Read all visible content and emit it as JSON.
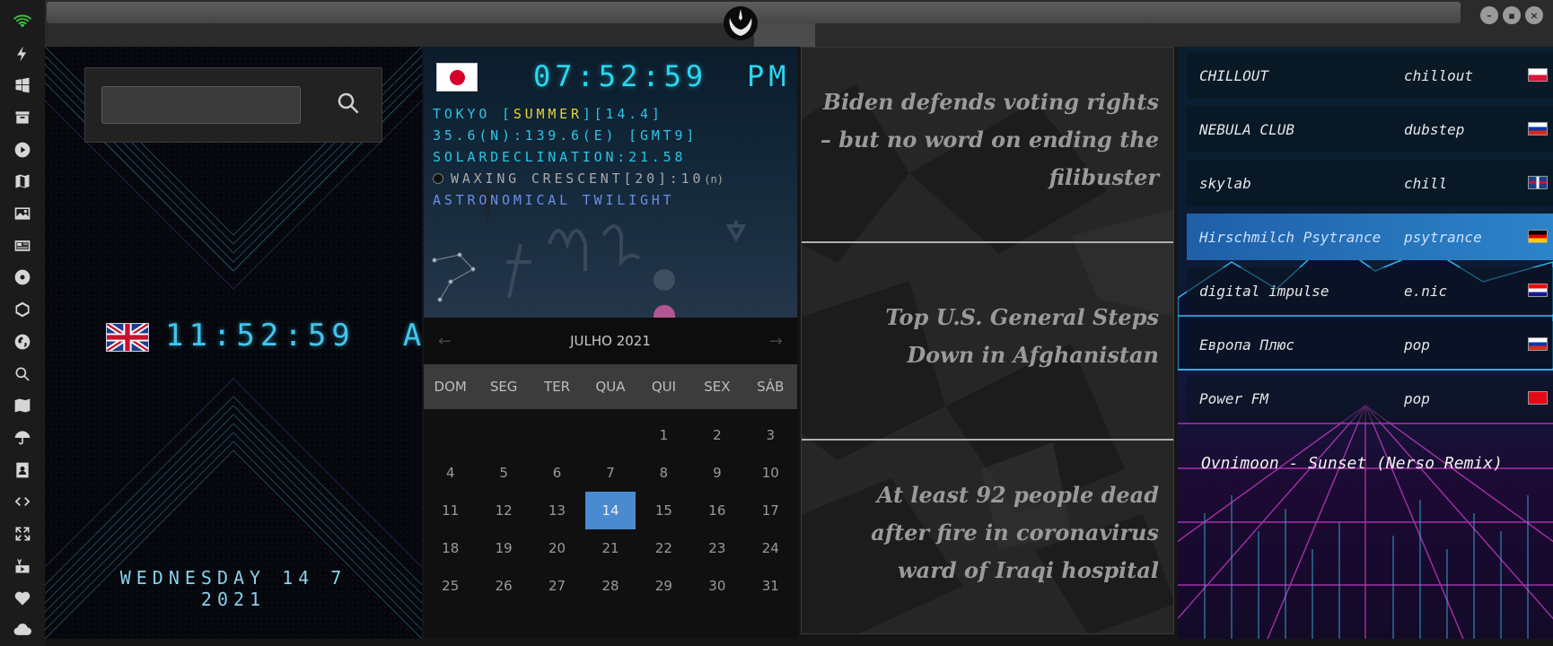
{
  "sidebar": {
    "icons": [
      "wifi-icon",
      "lightning-icon",
      "windows-icon",
      "archive-icon",
      "play-icon",
      "map-book-icon",
      "image-icon",
      "news-icon",
      "rebel-icon",
      "hexagon-icon",
      "globe-icon",
      "search-icon",
      "map-icon",
      "umbrella-icon",
      "contacts-icon",
      "code-icon",
      "expand-icon",
      "youtube-icon",
      "heart-icon",
      "cloud-icon"
    ],
    "wifi_color": "#39c640"
  },
  "clock_panel": {
    "time": "11:52:59",
    "ampm": "AM",
    "date": "WEDNESDAY 14 7 2021",
    "accent": "#41c6ee"
  },
  "astro_panel": {
    "time": "07:52:59",
    "ampm": "PM",
    "line1_a": "TOKYO [",
    "line1_season": "SUMMER",
    "line1_b": "][14.4]",
    "line2": "35.6(N):139.6(E) [GMT9]",
    "line3": "SOLARDECLINATION:21.58",
    "line4": "WAXING CRESCENT[20]:10",
    "line4_suffix": "(n)",
    "line5": "ASTRONOMICAL TWILIGHT"
  },
  "calendar": {
    "month_label": "JULHO 2021",
    "prev_arrow": "←",
    "next_arrow": "→",
    "weekdays": [
      "DOM",
      "SEG",
      "TER",
      "QUA",
      "QUI",
      "SEX",
      "SÁB"
    ],
    "days": [
      "",
      "",
      "",
      "",
      "1",
      "2",
      "3",
      "4",
      "5",
      "6",
      "7",
      "8",
      "9",
      "10",
      "11",
      "12",
      "13",
      "14",
      "15",
      "16",
      "17",
      "18",
      "19",
      "20",
      "21",
      "22",
      "23",
      "24",
      "25",
      "26",
      "27",
      "28",
      "29",
      "30",
      "31"
    ],
    "today": "14",
    "today_color": "#4a8ad0"
  },
  "news": {
    "headlines": [
      "Biden defends voting rights – but no word on ending the filibuster",
      "Top U.S. General Steps Down in Afghanistan",
      "At least 92 people dead after fire in coronavirus ward of Iraqi hospital"
    ]
  },
  "radio": {
    "stations": [
      {
        "name": "CHILLOUT",
        "genre": "chillout",
        "flag": "pl"
      },
      {
        "name": "NEBULA CLUB",
        "genre": "dubstep",
        "flag": "ru"
      },
      {
        "name": "skylab",
        "genre": "chill",
        "flag": "uk"
      },
      {
        "name": "Hirschmilch Psytrance",
        "genre": "psytrance",
        "flag": "de"
      },
      {
        "name": "digital impulse",
        "genre": "e.nic",
        "flag": "hr"
      },
      {
        "name": "Европа Плюс",
        "genre": "pop",
        "flag": "ru"
      },
      {
        "name": "Power FM",
        "genre": "pop",
        "flag": "tr"
      }
    ],
    "active_station": "Hirschmilch Psytrance",
    "now_playing": "Ovnimoon - Sunset (Nerso Remix)"
  }
}
